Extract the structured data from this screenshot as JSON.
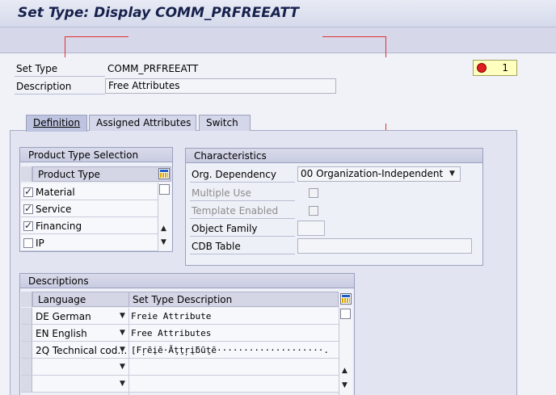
{
  "window": {
    "title": "Set Type: Display COMM_PRFREEATT"
  },
  "header": {
    "set_type_label": "Set Type",
    "set_type_value": "COMM_PRFREEATT",
    "description_label": "Description",
    "description_value": "Free Attributes",
    "status_count": "1"
  },
  "tabs": [
    {
      "label": "Definition"
    },
    {
      "label": "Assigned Attributes"
    },
    {
      "label": "Switch"
    }
  ],
  "product_type_selection": {
    "title": "Product Type Selection",
    "column_header": "Product Type",
    "rows": [
      {
        "label": "Material",
        "checked": true
      },
      {
        "label": "Service",
        "checked": true
      },
      {
        "label": "Financing",
        "checked": true
      },
      {
        "label": "IP",
        "checked": false
      }
    ]
  },
  "characteristics": {
    "title": "Characteristics",
    "org_dependency_label": "Org. Dependency",
    "org_dependency_value": "00 Organization-Independent",
    "multiple_use_label": "Multiple Use",
    "template_enabled_label": "Template Enabled",
    "object_family_label": "Object Family",
    "object_family_value": "",
    "cdb_table_label": "CDB Table",
    "cdb_table_value": ""
  },
  "descriptions": {
    "title": "Descriptions",
    "columns": [
      "Language",
      "Set Type Description"
    ],
    "rows": [
      {
        "language": "DE German",
        "description": "Freie Attribute"
      },
      {
        "language": "EN English",
        "description": "Free Attributes"
      },
      {
        "language": "2Q Technical cod…",
        "description": "[Fŗēįē·Āţţŗįƃũţē····················."
      },
      {
        "language": "",
        "description": ""
      },
      {
        "language": "",
        "description": ""
      }
    ]
  }
}
